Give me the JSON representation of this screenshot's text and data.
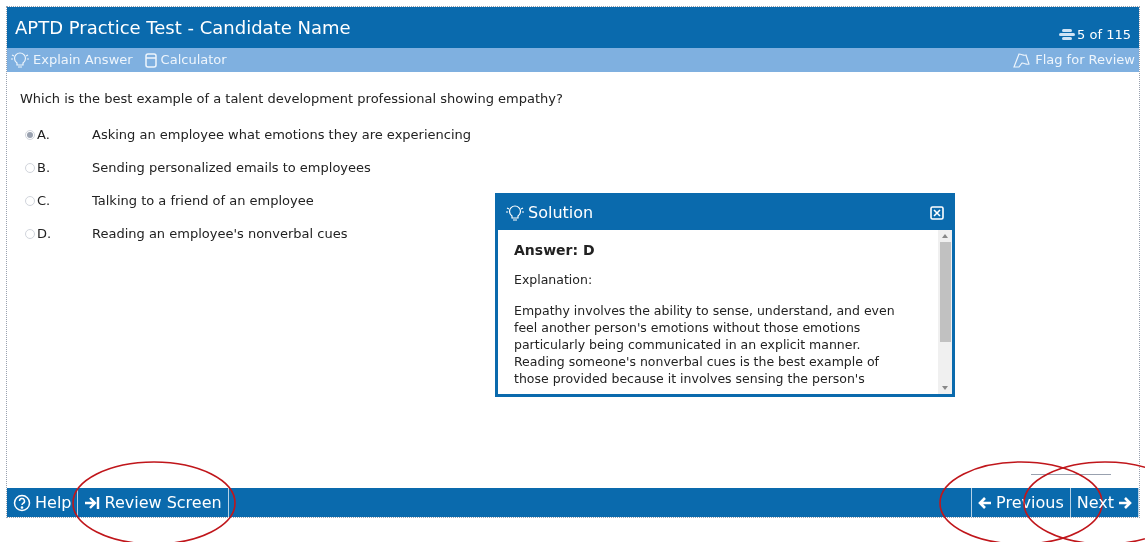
{
  "window": {
    "title": "APTD Practice Test - Candidate Name",
    "progress": "5 of 115"
  },
  "toolbar": {
    "left": [
      {
        "kind": "explain",
        "label": "Explain Answer"
      },
      {
        "kind": "calculator",
        "label": "Calculator"
      }
    ],
    "right": [
      {
        "kind": "flag",
        "label": "Flag for Review"
      }
    ]
  },
  "question": {
    "text": "Which is the best example of a talent development professional showing empathy?",
    "options": [
      {
        "letter": "A.",
        "text": "Asking an employee what emotions they are experiencing",
        "selected": true
      },
      {
        "letter": "B.",
        "text": "Sending personalized emails to employees",
        "selected": false
      },
      {
        "letter": "C.",
        "text": "Talking to a friend of an employee",
        "selected": false
      },
      {
        "letter": "D.",
        "text": "Reading an employee's nonverbal cues",
        "selected": false
      }
    ]
  },
  "solution": {
    "title": "Solution",
    "answer": "Answer: D",
    "heading": "Explanation:",
    "body": "Empathy involves the ability to sense, understand, and even feel another person's emotions without those emotions particularly being communicated in an explicit manner. Reading someone's nonverbal cues is the best example of those provided because it involves sensing the person's"
  },
  "footer": {
    "left": [
      {
        "kind": "help",
        "label": "Help"
      },
      {
        "kind": "review",
        "label": "Review Screen",
        "circled": true
      }
    ],
    "right": [
      {
        "kind": "previous",
        "label": "Previous",
        "circled": true
      },
      {
        "kind": "next",
        "label": "Next",
        "circled": true
      }
    ]
  }
}
